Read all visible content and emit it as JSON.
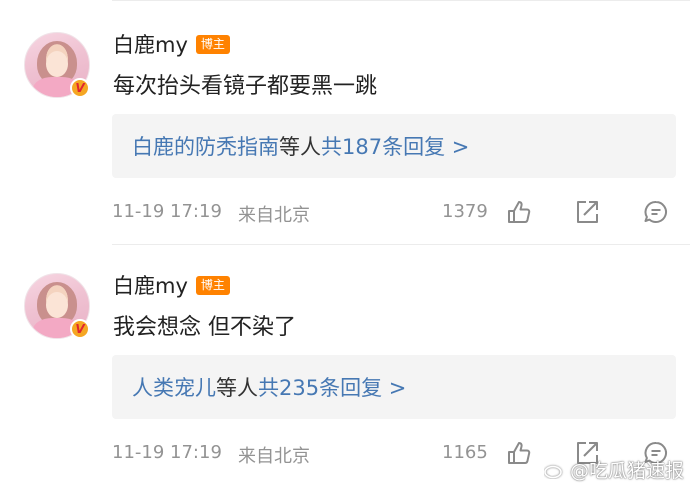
{
  "comments": [
    {
      "username": "白鹿my",
      "badge": "博主",
      "text": "每次抬头看镜子都要黑一跳",
      "reply_users": "白鹿的防秃指南",
      "reply_mid": "等人",
      "reply_count": "共187条回复 >",
      "time": "11-19 17:19",
      "location": "来自北京",
      "likes": "1379"
    },
    {
      "username": "白鹿my",
      "badge": "博主",
      "text": "我会想念 但不染了",
      "reply_users": "人类宠儿",
      "reply_mid": "等人",
      "reply_count": "共235条回复 >",
      "time": "11-19 17:19",
      "location": "来自北京",
      "likes": "1165"
    }
  ],
  "avatar_badge": "V",
  "watermark": "@吃瓜猪速报",
  "icons": [
    "thumbs-up-icon",
    "share-icon",
    "comment-icon"
  ],
  "colors": {
    "accent_blue": "#4678b3",
    "badge_orange": "#ff8200",
    "meta_gray": "#939393"
  }
}
